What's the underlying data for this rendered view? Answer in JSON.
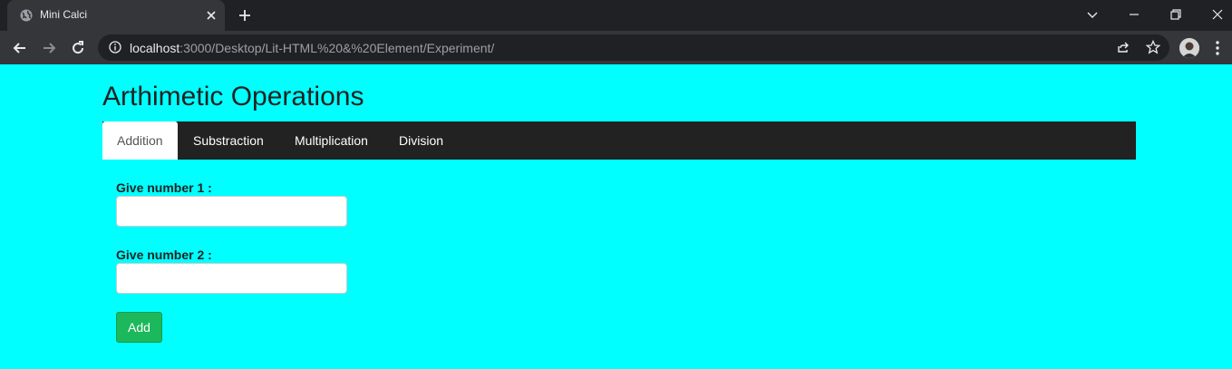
{
  "browser": {
    "tab_title": "Mini Calci",
    "url_host": "localhost",
    "url_rest": ":3000/Desktop/Lit-HTML%20&%20Element/Experiment/"
  },
  "page": {
    "title": "Arthimetic Operations",
    "tabs": [
      {
        "label": "Addition",
        "active": true
      },
      {
        "label": "Substraction",
        "active": false
      },
      {
        "label": "Multiplication",
        "active": false
      },
      {
        "label": "Division",
        "active": false
      }
    ],
    "form": {
      "number1_label": "Give number 1 :",
      "number1_value": "",
      "number2_label": "Give number 2 :",
      "number2_value": "",
      "submit_label": "Add"
    }
  },
  "colors": {
    "background": "#00ffff",
    "nav_bar": "#222222",
    "button": "#1cb85c"
  }
}
